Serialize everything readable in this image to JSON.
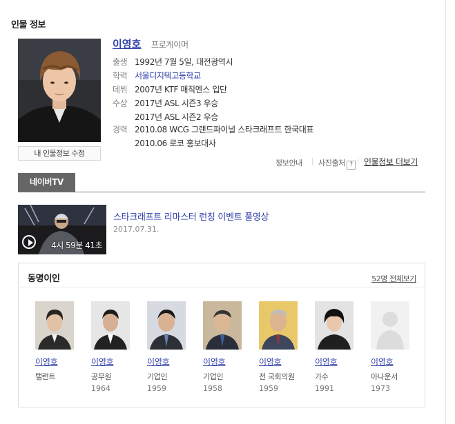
{
  "section_title": "인물 정보",
  "profile": {
    "name": "이영호",
    "job": "프로게이머",
    "edit_button": "내 인물정보 수정",
    "rows": [
      {
        "key": "출생",
        "values": [
          "1992년 7월 5일, 대전광역시"
        ]
      },
      {
        "key": "학력",
        "values": [
          "서울디지텍고등학교"
        ]
      },
      {
        "key": "데뷔",
        "values": [
          "2007년 KTF 매직엔스 입단"
        ]
      },
      {
        "key": "수상",
        "values": [
          "2017년 ASL 시즌3 우승",
          "2017년 ASL 시즌2 우승"
        ]
      },
      {
        "key": "경력",
        "values": [
          "2010.08 WCG 그랜드파이널 스타크래프트 한국대표",
          "2010.06 로코 홍보대사"
        ]
      }
    ]
  },
  "utility": {
    "info_guide": "정보안내",
    "photo_source": "사진출처",
    "help_mark": "?",
    "more": "인물정보 더보기"
  },
  "tv": {
    "tab_label": "네이버TV",
    "video": {
      "title": "스타크래프트 리마스터 런칭 이벤트 풀영상",
      "date": "2017.07.31.",
      "duration": "4시 59분 41초"
    }
  },
  "namesakes": {
    "title": "동명이인",
    "all_link": "52명 전체보기",
    "people": [
      {
        "name": "이영호",
        "job": "탤런트",
        "year": ""
      },
      {
        "name": "이영호",
        "job": "공무원",
        "year": "1964"
      },
      {
        "name": "이영호",
        "job": "기업인",
        "year": "1959"
      },
      {
        "name": "이영호",
        "job": "기업인",
        "year": "1958"
      },
      {
        "name": "이영호",
        "job": "전 국회의원",
        "year": "1959"
      },
      {
        "name": "이영호",
        "job": "가수",
        "year": "1991"
      },
      {
        "name": "이영호",
        "job": "아나운서",
        "year": "1973"
      }
    ]
  }
}
